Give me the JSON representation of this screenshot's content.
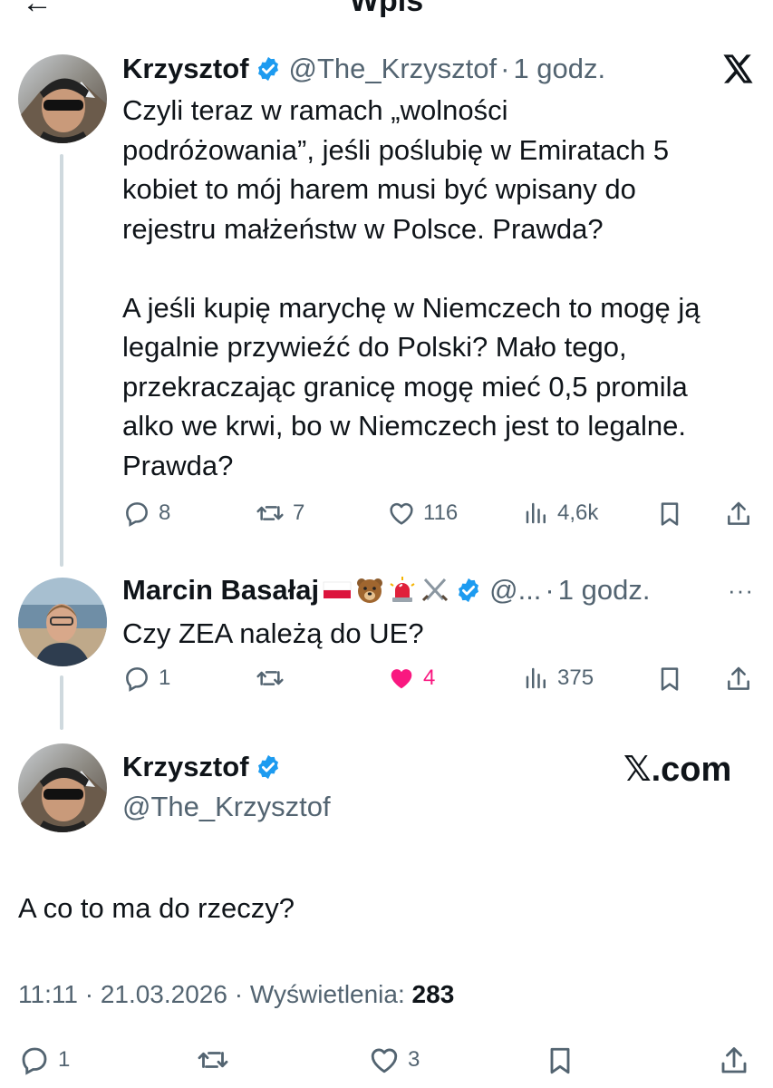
{
  "header": {
    "title": "Wpis",
    "back_icon": "back-arrow-icon"
  },
  "colors": {
    "text": "#0f1419",
    "secondary": "#536471",
    "verified": "#1d9bf0",
    "like": "#f91880",
    "thread_line": "#cfd9de"
  },
  "tweet1": {
    "name": "Krzysztof",
    "handle": "@The_Krzysztof",
    "time": "1 godz.",
    "text": "Czyli teraz w ramach „wolności\npodróżowania”, jeśli poślubię w Emiratach 5\nkobiet to mój harem musi być wpisany do\nrejestru małżeństw w Polsce. Prawda?\n\nA jeśli kupię marychę w Niemczech to mogę ją\nlegalnie przywieźć do Polski? Mało tego,\nprzekraczając granicę mogę mieć 0,5 promila\nalko we krwi, bo w Niemczech jest to legalne.\nPrawda?",
    "replies": "8",
    "reposts": "7",
    "likes": "116",
    "views": "4,6k"
  },
  "tweet2": {
    "name": "Marcin Basałaj",
    "handle": "@...",
    "time": "1 godz.",
    "text": "Czy ZEA należą do UE?",
    "replies": "1",
    "reposts": "",
    "likes": "4",
    "views": "375"
  },
  "tweet3": {
    "name": "Krzysztof",
    "handle": "@The_Krzysztof",
    "xcom": "𝕏.com",
    "text": "A co to ma do rzeczy?",
    "time": "11:11",
    "date": "21.03.2026",
    "views_label": "Wyświetlenia:",
    "views": "283",
    "replies": "1",
    "reposts": "",
    "likes": "3"
  }
}
